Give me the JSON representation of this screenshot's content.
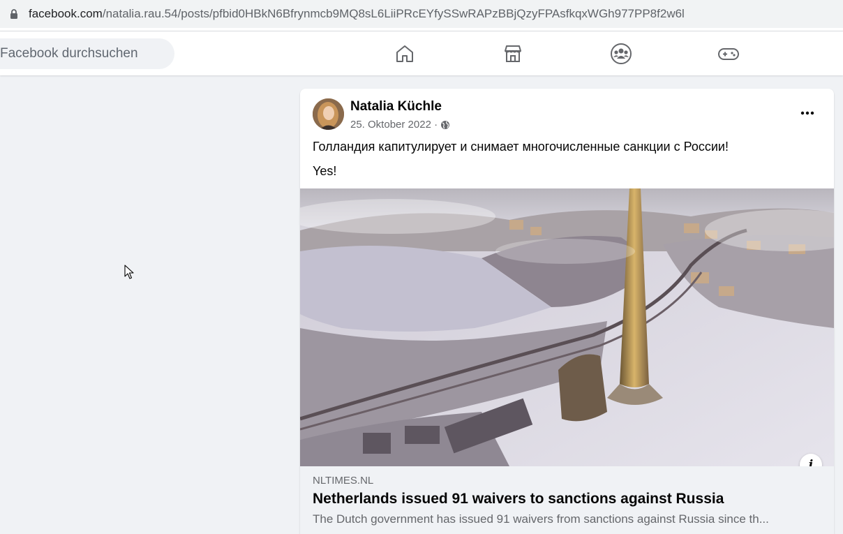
{
  "browser": {
    "url_host": "facebook.com",
    "url_path": "/natalia.rau.54/posts/pfbid0HBkN6Bfrynmcb9MQ8sL6LiiPRcEYfySSwRAPzBBjQzyFPAsfkqxWGh977PP8f2w6l"
  },
  "topnav": {
    "search_placeholder": "Facebook durchsuchen",
    "icons": [
      "home-icon",
      "marketplace-icon",
      "groups-icon",
      "gaming-icon"
    ]
  },
  "post": {
    "author": "Natalia Küchle",
    "date": "25. Oktober 2022 ·",
    "text_line_1": "Голландия капитулирует и снимает многочисленные санкции с России!",
    "text_line_2": "Yes!",
    "link": {
      "domain": "NLTIMES.NL",
      "title": "Netherlands issued 91 waivers to sanctions against Russia",
      "description": "The Dutch government has issued 91 waivers from sanctions against Russia since th..."
    }
  },
  "colors": {
    "background": "#f0f2f5",
    "card": "#ffffff",
    "secondary_text": "#65676b",
    "icon_gray": "#65676b"
  }
}
